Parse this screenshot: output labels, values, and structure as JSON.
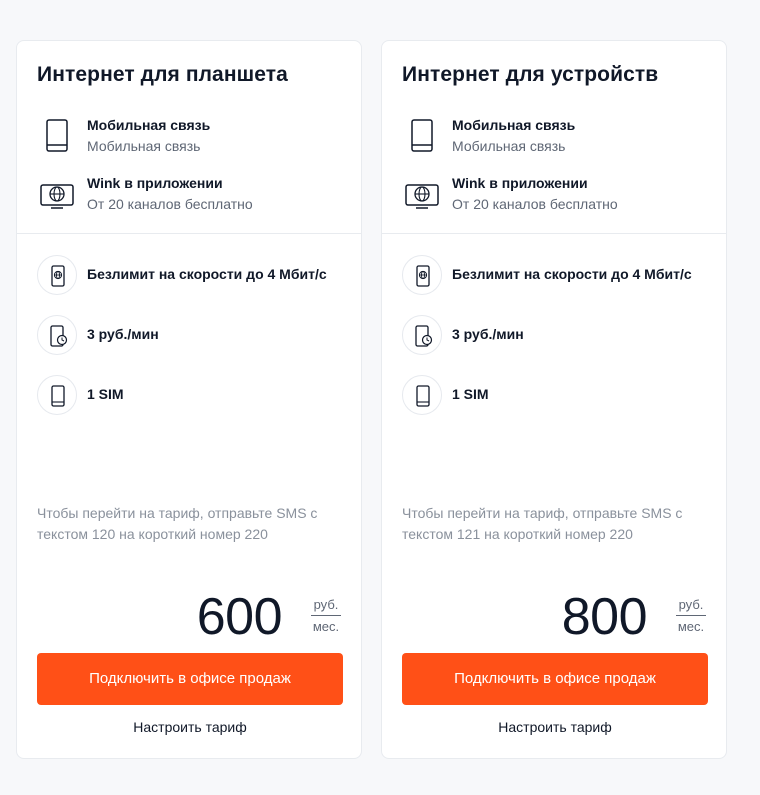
{
  "colors": {
    "accent": "#ff5017",
    "text": "#101828",
    "muted": "#5f6775",
    "note": "#8a919c"
  },
  "cards": [
    {
      "title": "Интернет для планшета",
      "features": [
        {
          "icon": "tablet-icon",
          "title": "Мобильная связь",
          "subtitle": "Мобильная связь"
        },
        {
          "icon": "tv-globe-icon",
          "title": "Wink в приложении",
          "subtitle": "От 20 каналов бесплатно"
        }
      ],
      "options": [
        {
          "icon": "phone-globe-icon",
          "label": "Безлимит на скорости до 4 Мбит/с"
        },
        {
          "icon": "phone-clock-icon",
          "label": "3 руб./мин"
        },
        {
          "icon": "sim-phone-icon",
          "label": "1 SIM"
        }
      ],
      "note": "Чтобы перейти на тариф, отправьте SMS с текстом 120 на короткий номер 220",
      "price": "600",
      "unit_top": "руб.",
      "unit_bottom": "мес.",
      "button": "Подключить в офисе продаж",
      "link": "Настроить тариф"
    },
    {
      "title": "Интернет для устройств",
      "features": [
        {
          "icon": "tablet-icon",
          "title": "Мобильная связь",
          "subtitle": "Мобильная связь"
        },
        {
          "icon": "tv-globe-icon",
          "title": "Wink в приложении",
          "subtitle": "От 20 каналов бесплатно"
        }
      ],
      "options": [
        {
          "icon": "phone-globe-icon",
          "label": "Безлимит на скорости до 4 Мбит/с"
        },
        {
          "icon": "phone-clock-icon",
          "label": "3 руб./мин"
        },
        {
          "icon": "sim-phone-icon",
          "label": "1 SIM"
        }
      ],
      "note": "Чтобы перейти на тариф, отправьте SMS с текстом 121 на короткий номер 220",
      "price": "800",
      "unit_top": "руб.",
      "unit_bottom": "мес.",
      "button": "Подключить в офисе продаж",
      "link": "Настроить тариф"
    }
  ]
}
